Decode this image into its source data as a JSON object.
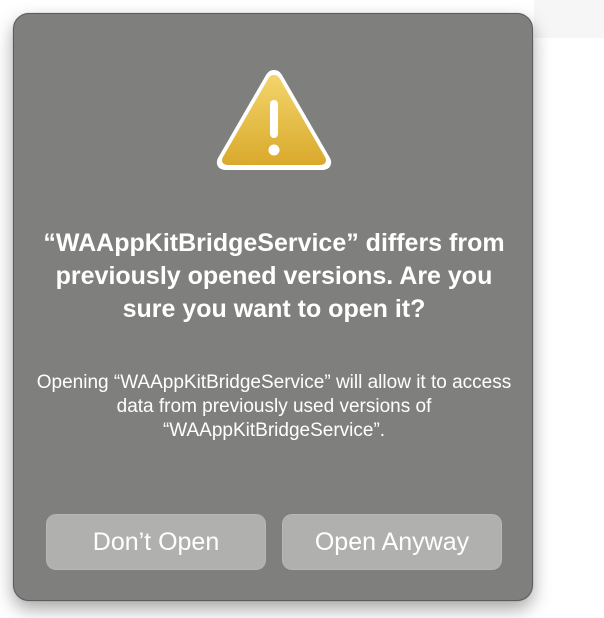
{
  "dialog": {
    "title": "“WAAppKitBridgeService” differs from previously opened versions. Are you sure you want to open it?",
    "message": "Opening “WAAppKitBridgeService” will allow it to access data from previously used versions of “WAAppKitBridgeService”.",
    "icon": "warning-icon",
    "buttons": {
      "dont_open": "Don’t Open",
      "open_anyway": "Open Anyway"
    }
  },
  "colors": {
    "dialog_bg": "#7f807e",
    "button_bg": "#b0b1af",
    "icon_yellow": "#e9c14a"
  }
}
